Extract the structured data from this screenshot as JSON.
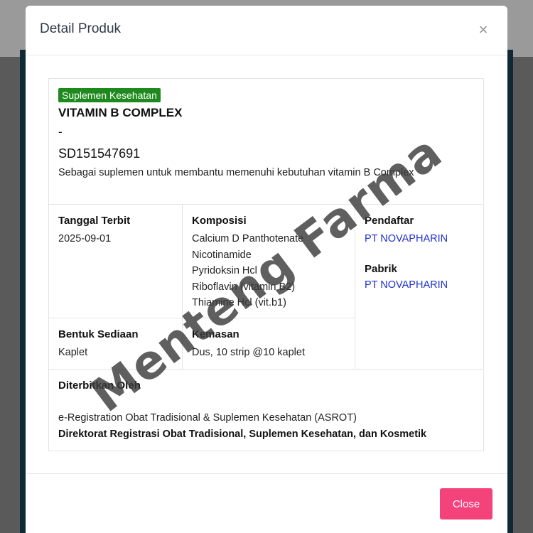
{
  "modal": {
    "title": "Detail Produk",
    "close_icon": "×",
    "close_button_label": "Close"
  },
  "product": {
    "category": "Suplemen Kesehatan",
    "name": "VITAMIN B COMPLEX",
    "dash": "-",
    "registration_number": "SD151547691",
    "description": "Sebagai suplemen untuk membantu memenuhi kebutuhan vitamin B Complex"
  },
  "details": {
    "tanggal_terbit_label": "Tanggal Terbit",
    "tanggal_terbit_value": "2025-09-01",
    "komposisi_label": "Komposisi",
    "komposisi_items": [
      "Calcium D Panthotenate",
      "Nicotinamide",
      "Pyridoksin Hcl",
      "Riboflavin (vitamin B2)",
      "Thiamine Hcl (vit.b1)"
    ],
    "pendaftar_label": "Pendaftar",
    "pendaftar_value": "PT NOVAPHARIN",
    "pabrik_label": "Pabrik",
    "pabrik_value": "PT NOVAPHARIN",
    "bentuk_sediaan_label": "Bentuk Sediaan",
    "bentuk_sediaan_value": "Kaplet",
    "kemasan_label": "Kemasan",
    "kemasan_value": "Dus, 10 strip @10 kaplet"
  },
  "issuer": {
    "label": "Diterbitkan Oleh",
    "system": "e-Registration Obat Tradisional & Suplemen Kesehatan (ASROT)",
    "directorate": "Direktorat Registrasi Obat Tradisional, Suplemen Kesehatan, dan Kosmetik"
  },
  "watermark": {
    "text": "Menteng Farma"
  },
  "colors": {
    "badge": "#1e8a1e",
    "link": "#1d2fd0",
    "close_button": "#f3437a"
  }
}
